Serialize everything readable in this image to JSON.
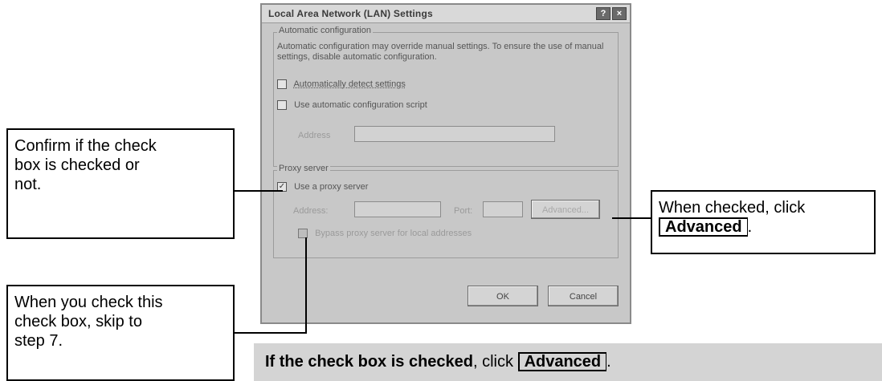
{
  "dialog": {
    "title": "Local Area Network (LAN) Settings",
    "help_label": "?",
    "close_label": "×",
    "auto_group": {
      "title": "Automatic configuration",
      "description": "Automatic configuration may override manual settings.  To ensure the use of manual settings, disable automatic configuration.",
      "auto_detect_label": "Automatically detect settings",
      "auto_detect_checked": false,
      "script_label": "Use automatic configuration script",
      "script_checked": false,
      "address_label": "Address"
    },
    "proxy_group": {
      "title": "Proxy server",
      "use_proxy_label": "Use a proxy server",
      "use_proxy_checked": true,
      "address_label": "Address:",
      "port_label": "Port:",
      "advanced_label": "Advanced...",
      "bypass_label": "Bypass proxy server for local addresses",
      "bypass_checked": false
    },
    "ok_label": "OK",
    "cancel_label": "Cancel"
  },
  "callouts": {
    "confirm": {
      "lines": [
        "Confirm if the check",
        "box is checked or",
        "not."
      ]
    },
    "skip": {
      "lines": [
        "When you check this",
        "check box, skip to",
        "step 7."
      ]
    },
    "advanced": {
      "line1": "When checked, click",
      "button_label": "Advanced",
      "suffix": "."
    }
  },
  "banner": {
    "bold_text": "If the check box is checked",
    "middle_text": ", click ",
    "button_label": "Advanced",
    "suffix": "."
  },
  "colors": {
    "dialog_bg": "#c8c8c8",
    "banner_bg": "#d4d4d4",
    "callout_border": "#000000"
  }
}
